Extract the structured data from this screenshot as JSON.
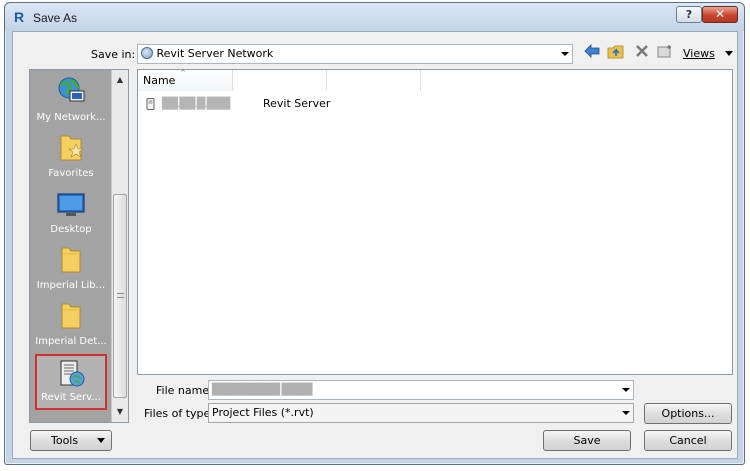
{
  "window": {
    "title": "Save As",
    "app_icon": "revit-r-icon",
    "help_label": "?",
    "close_label": "✕"
  },
  "toolbar": {
    "save_in_label": "Save in:",
    "save_in_value": "Revit Server Network",
    "views_label": "Views",
    "icons": [
      "back-arrow-icon",
      "up-folder-icon",
      "delete-icon",
      "new-folder-icon"
    ]
  },
  "places": [
    {
      "label": "My Network...",
      "icon": "network-globe-icon"
    },
    {
      "label": "Favorites",
      "icon": "favorites-folder-icon"
    },
    {
      "label": "Desktop",
      "icon": "desktop-icon"
    },
    {
      "label": "Imperial Lib...",
      "icon": "folder-icon"
    },
    {
      "label": "Imperial Det...",
      "icon": "folder-icon"
    },
    {
      "label": "Revit Serv...",
      "icon": "revit-server-icon",
      "selected": true
    }
  ],
  "filelist": {
    "columns": [
      "Name"
    ],
    "rows": [
      {
        "name": "██.██.█.███",
        "type": "Revit Server"
      }
    ]
  },
  "form": {
    "file_name_label": "File name:",
    "file_name_value": "█████████ ████",
    "files_of_type_label": "Files of type:",
    "files_of_type_value": "Project Files  (*.rvt)"
  },
  "buttons": {
    "options": "Options...",
    "tools": "Tools",
    "save": "Save",
    "cancel": "Cancel"
  },
  "colors": {
    "accent_frame": "#c4d4e6",
    "places_background": "#a3a3a3",
    "selection_highlight": "#d03030"
  }
}
